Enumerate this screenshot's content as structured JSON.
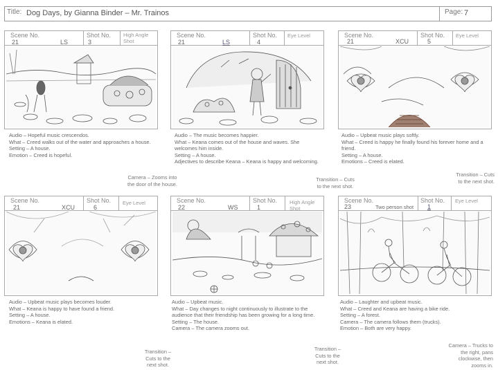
{
  "header": {
    "title_label": "Title:",
    "title": "Dog Days, by Gianna Binder – Mr. Trainos",
    "page_label": "Page:",
    "page": "7"
  },
  "panels": [
    {
      "scene_label": "Scene No.",
      "scene": "21",
      "shot_type": "LS",
      "shot_label": "Shot No.",
      "shot": "3",
      "angle": "High Angle Shot",
      "description": "Audio – Hopeful music crescendos.\nWhat – Creed walks out of the water and approaches a house.\nSetting – A house.\nEmotion – Creed is hopeful."
    },
    {
      "scene_label": "Scene No.",
      "scene": "21",
      "shot_type": "LS",
      "shot_label": "Shot No.",
      "shot": "4",
      "angle": "Eye Level",
      "description": "Audio – The music becomes happier.\nWhat – Keana comes out of the house and waves. She welcomes him inside.\nSetting – A house.\nAdjectives to describe Keana – Keana is happy and welcoming."
    },
    {
      "scene_label": "Scene No.",
      "scene": "21",
      "shot_type": "XCU",
      "shot_label": "Shot No.",
      "shot": "5",
      "angle": "Eye Level",
      "description": "Audio – Upbeat music plays softly.\nWhat – Creed is happy he finally found his forever home and a friend.\nSetting – A house.\nEmotions – Creed is elated."
    },
    {
      "scene_label": "Scene No.",
      "scene": "21",
      "shot_type": "XCU",
      "shot_label": "Shot No.",
      "shot": "6",
      "angle": "Eye Level",
      "description": "Audio – Upbeat music plays becomes louder.\nWhat – Keana is happy to have found a friend.\nSetting – A house.\nEmotions – Keana is elated."
    },
    {
      "scene_label": "Scene No.",
      "scene": "22",
      "shot_type": "WS",
      "shot_label": "Shot No.",
      "shot": "1",
      "angle": "High Angle Shot",
      "description": "Audio – Upbeat music.\nWhat – Day changes to night continuously to illustrate to the audience that their friendship has been growing for a long time.\nSetting – The house.\nCamera –  The camera zooms out."
    },
    {
      "scene_label": "Scene No.",
      "scene": "23",
      "shot_type": "Two person shot",
      "shot_label": "Shot No.",
      "shot": "1",
      "angle": "Eye Level",
      "description": "Audio – Laughter and upbeat music.\nWhat – Creed and Keana are having a bike ride.\nSetting – A forest.\nCamera – The camera follows them (trucks).\nEmotion – Both are very happy."
    }
  ],
  "notes": {
    "n1": "Camera – Zooms into\nthe door of the house.",
    "n2": "Transition – Cuts\nto the next shot.",
    "n3": "Transition – Cuts\nto the next shot.",
    "n4": "Transition –\nCuts to the\nnext shot.",
    "n5": "Transition –\nCuts to the\nnext shot.",
    "n6": "Camera – Trucks to\nthe right, pans\nclockwise, then\nzooms in."
  }
}
